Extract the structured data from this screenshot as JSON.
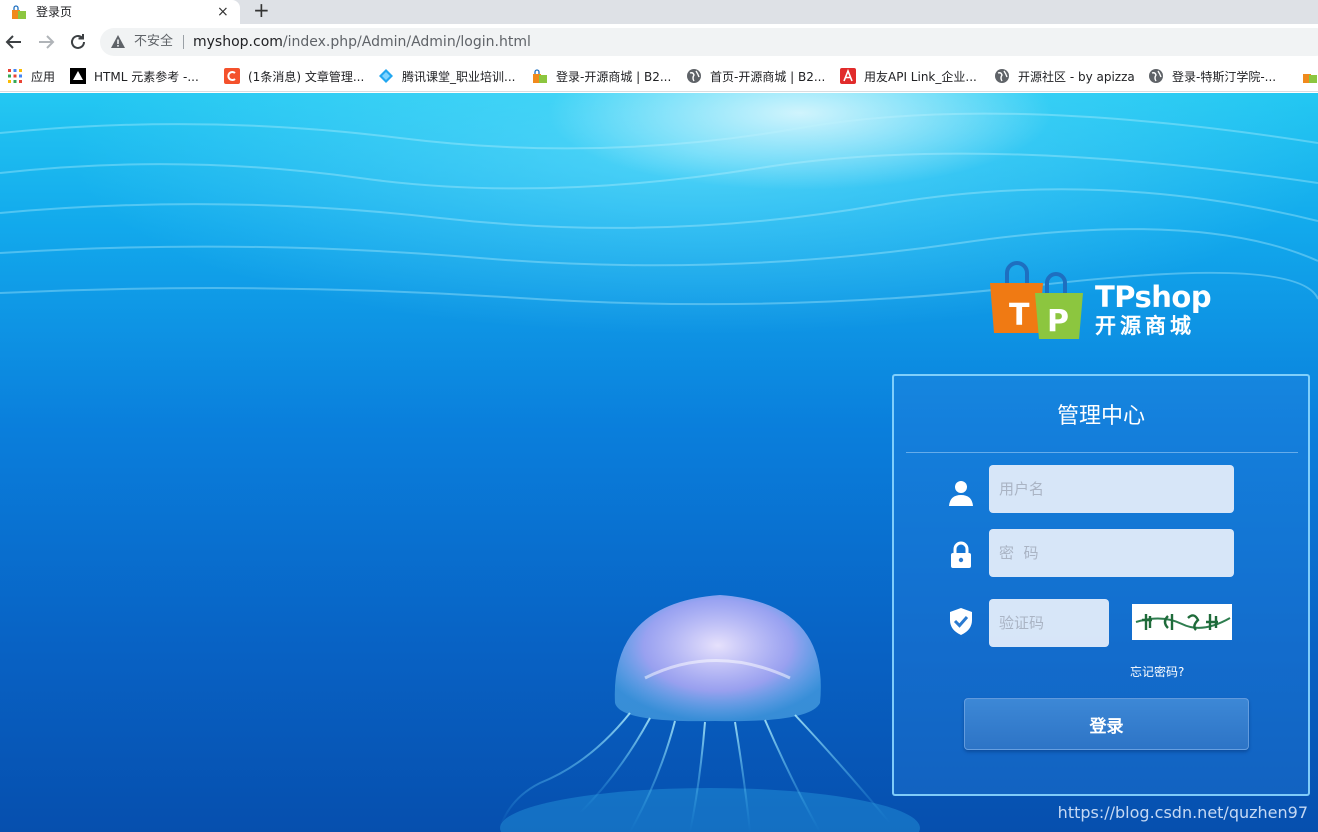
{
  "browser": {
    "tab": {
      "title": "登录页",
      "close": "×"
    },
    "new_tab": "+",
    "address": {
      "security_label": "不安全",
      "host": "myshop.com",
      "path": "/index.php/Admin/Admin/login.html"
    },
    "bookmarks": [
      {
        "label": "应用",
        "icon": "apps-grid-icon"
      },
      {
        "label": "HTML 元素参考 -...",
        "icon": "mdn-icon"
      },
      {
        "label": "(1条消息) 文章管理...",
        "icon": "csdn-icon"
      },
      {
        "label": "腾讯课堂_职业培训...",
        "icon": "tencent-class-icon"
      },
      {
        "label": "登录-开源商城 | B2...",
        "icon": "tpshop-icon"
      },
      {
        "label": "首页-开源商城 | B2...",
        "icon": "globe-icon"
      },
      {
        "label": "用友API Link_企业...",
        "icon": "yonyou-icon"
      },
      {
        "label": "开源社区 - by apizza",
        "icon": "globe-icon"
      },
      {
        "label": "登录-特斯汀学院-...",
        "icon": "globe-icon"
      }
    ]
  },
  "logo": {
    "brand": "TPshop",
    "subtitle": "开源商城",
    "badge_letters": [
      "T",
      "P"
    ]
  },
  "login": {
    "title": "管理中心",
    "username_placeholder": "用户名",
    "password_placeholder": "密  码",
    "captcha_placeholder": "验证码",
    "forgot_label": "忘记密码?",
    "submit_label": "登录"
  },
  "watermark": "https://blog.csdn.net/quzhen97",
  "colors": {
    "accent": "#2d74c6",
    "page_top": "#24c8f2",
    "page_bottom": "#064fae"
  }
}
